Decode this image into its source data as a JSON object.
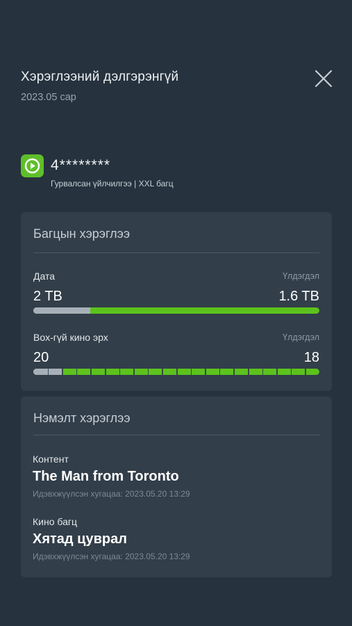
{
  "header": {
    "title": "Хэрэглээний дэлгэрэнгүй",
    "period": "2023.05 сар"
  },
  "account": {
    "number": "4********",
    "description": "Гурвалсан үйлчилгээ | XXL багц"
  },
  "package_usage": {
    "title": "Багцын хэрэглээ",
    "items": [
      {
        "label": "Дата",
        "remaining_label": "Үлдэгдэл",
        "total": "2 TB",
        "remaining": "1.6 TB",
        "used_fraction": 0.2,
        "segmented": false
      },
      {
        "label": "Box-гүй кино эрх",
        "remaining_label": "Үлдэгдэл",
        "total": "20",
        "remaining": "18",
        "used_fraction": 0.1,
        "segments": 20,
        "segmented": true
      }
    ]
  },
  "extra_usage": {
    "title": "Нэмэлт хэрэглээ",
    "items": [
      {
        "category": "Контент",
        "name": "The Man from Toronto",
        "activated": "Идэвхжүүлсэн хугацаа: 2023.05.20 13:29"
      },
      {
        "category": "Кино багц",
        "name": "Хятад цуврал",
        "activated": "Идэвхжүүлсэн хугацаа: 2023.05.20 13:29"
      }
    ]
  },
  "colors": {
    "background": "#26323d",
    "card": "#323e49",
    "accent_green": "#5cc21d",
    "used_gray": "#a7b0b8"
  },
  "icons": {
    "close": "close-icon",
    "logo": "play-logo-icon"
  }
}
